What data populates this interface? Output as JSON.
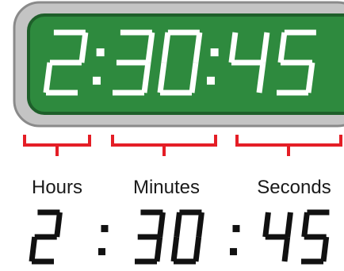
{
  "display": {
    "time_text": "2:30:45",
    "bezel_color": "#c4c4c4",
    "bezel_edge_color": "#8a8a8a",
    "screen_color": "#2e8a3e",
    "screen_edge_color": "#1e5f2a",
    "digit_color": "#ffffff"
  },
  "brackets": {
    "color": "#e41e26"
  },
  "labels": {
    "hours": "Hours",
    "minutes": "Minutes",
    "seconds": "Seconds"
  },
  "readout": {
    "hours": "2",
    "sep1": ":",
    "minutes": "30",
    "sep2": ":",
    "seconds": "45",
    "color": "#111111"
  }
}
